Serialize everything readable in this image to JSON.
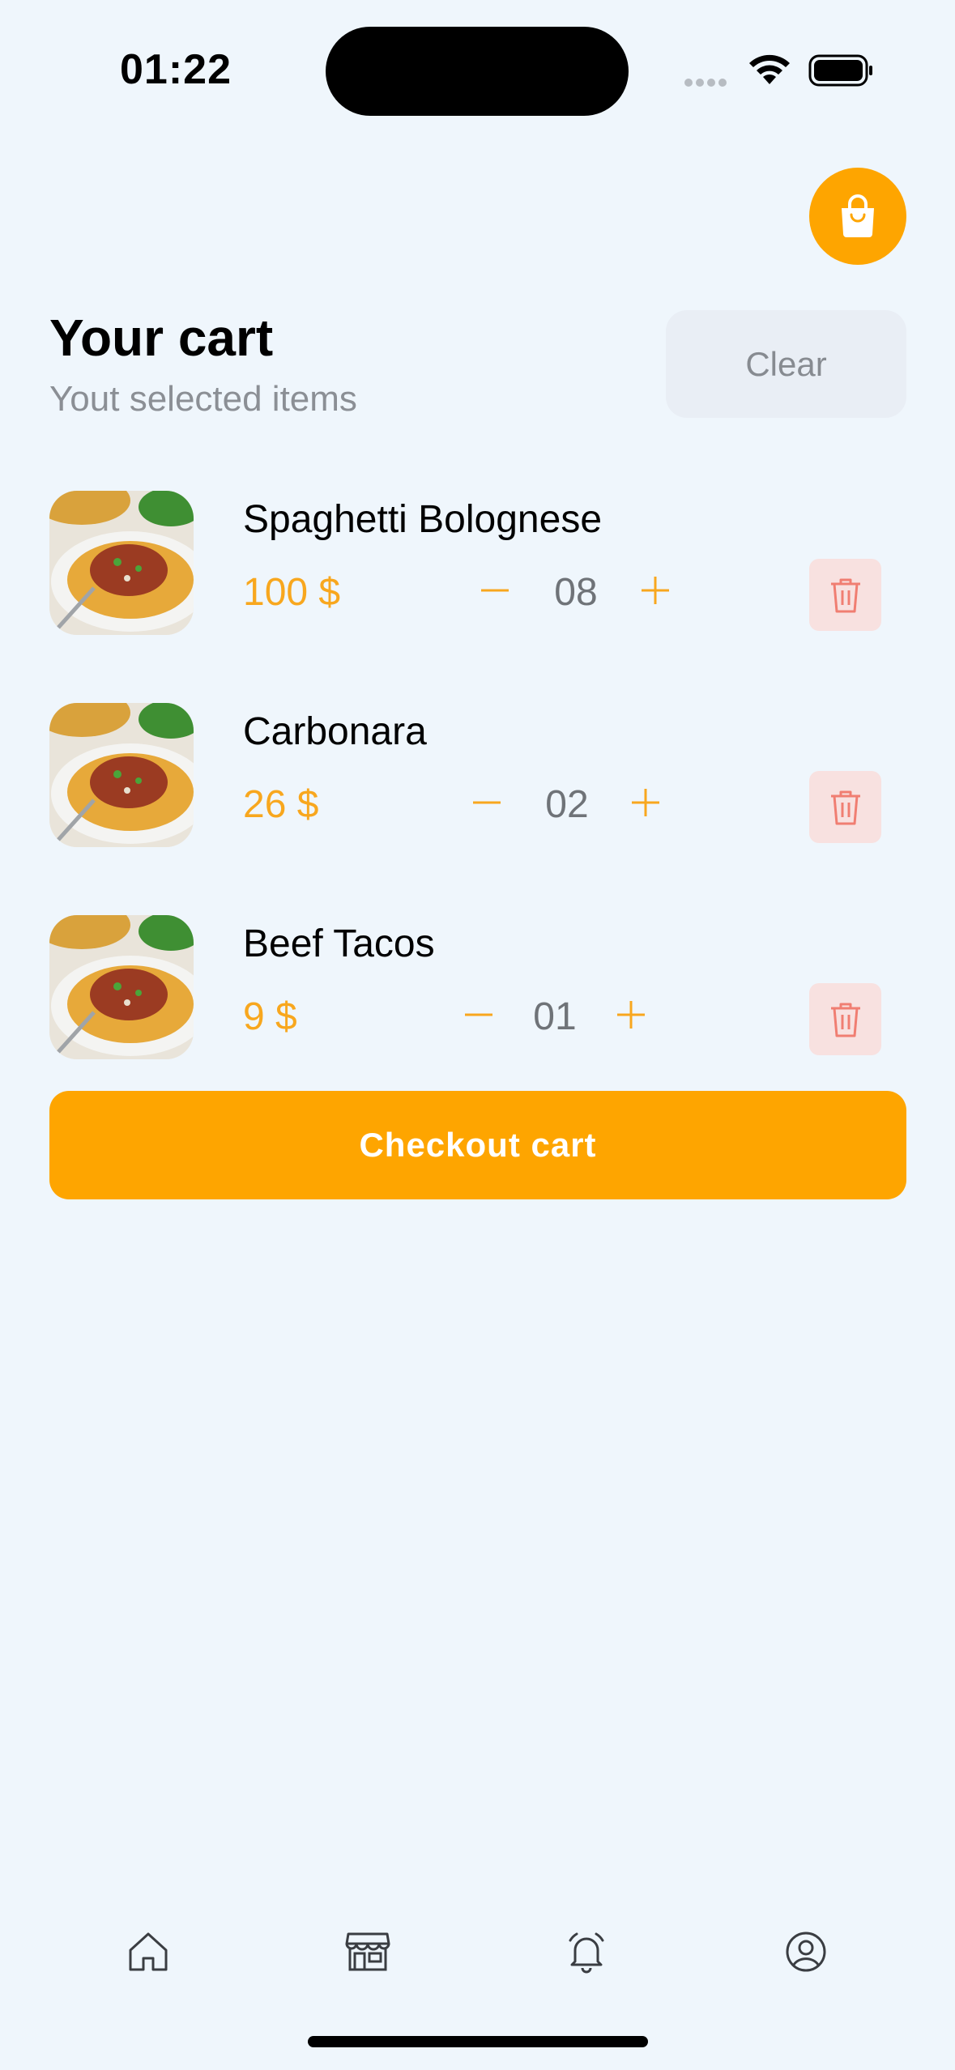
{
  "status_bar": {
    "time": "01:22"
  },
  "header": {
    "title": "Your cart",
    "subtitle": "Yout selected items",
    "clear_label": "Clear"
  },
  "cart": {
    "items": [
      {
        "name": "Spaghetti Bolognese",
        "price": "100 $",
        "quantity": "08"
      },
      {
        "name": "Carbonara",
        "price": "26 $",
        "quantity": "02"
      },
      {
        "name": "Beef Tacos",
        "price": "9 $",
        "quantity": "01"
      }
    ]
  },
  "checkout": {
    "label": "Checkout cart"
  },
  "tab_bar": {
    "icons": [
      "home-icon",
      "store-icon",
      "bell-icon",
      "profile-icon"
    ]
  },
  "colors": {
    "accent": "#fea500",
    "price": "#f8a71e",
    "delete_bg": "#f8e1e0",
    "delete_icon": "#f07e72",
    "background": "#eff6fc"
  }
}
